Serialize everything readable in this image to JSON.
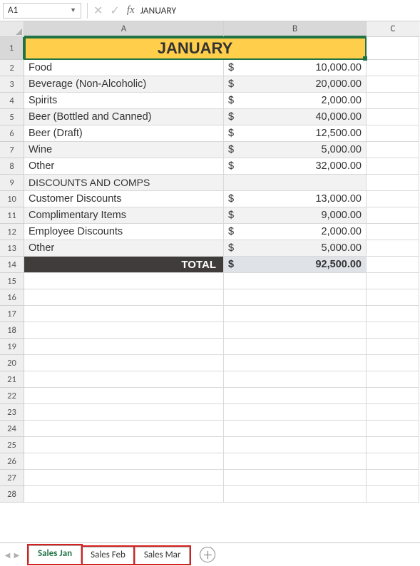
{
  "formula_bar": {
    "cell_ref": "A1",
    "formula_value": "JANUARY"
  },
  "columns": {
    "A": "A",
    "B": "B",
    "C": "C"
  },
  "title": "JANUARY",
  "items": [
    {
      "label": "Food",
      "amount": "10,000.00"
    },
    {
      "label": "Beverage (Non-Alcoholic)",
      "amount": "20,000.00"
    },
    {
      "label": "Spirits",
      "amount": "2,000.00"
    },
    {
      "label": "Beer (Bottled and Canned)",
      "amount": "40,000.00"
    },
    {
      "label": "Beer (Draft)",
      "amount": "12,500.00"
    },
    {
      "label": "Wine",
      "amount": "5,000.00"
    },
    {
      "label": "Other",
      "amount": "32,000.00"
    }
  ],
  "section_header": "DISCOUNTS AND COMPS",
  "discounts": [
    {
      "label": "Customer Discounts",
      "amount": "13,000.00"
    },
    {
      "label": "Complimentary Items",
      "amount": "9,000.00"
    },
    {
      "label": "Employee Discounts",
      "amount": "2,000.00"
    },
    {
      "label": "Other",
      "amount": "5,000.00"
    }
  ],
  "total": {
    "label": "TOTAL",
    "amount": "92,500.00"
  },
  "currency_symbol": "$",
  "row_headers": [
    "1",
    "2",
    "3",
    "4",
    "5",
    "6",
    "7",
    "8",
    "9",
    "10",
    "11",
    "12",
    "13",
    "14",
    "15",
    "16",
    "17",
    "18",
    "19",
    "20",
    "21",
    "22",
    "23",
    "24",
    "25",
    "26",
    "27",
    "28"
  ],
  "tabs": [
    {
      "label": "Sales  Jan",
      "active": true
    },
    {
      "label": "Sales Feb",
      "active": false
    },
    {
      "label": "Sales Mar",
      "active": false
    }
  ],
  "chart_data": {
    "type": "table",
    "title": "JANUARY",
    "rows": [
      [
        "Food",
        10000.0
      ],
      [
        "Beverage (Non-Alcoholic)",
        20000.0
      ],
      [
        "Spirits",
        2000.0
      ],
      [
        "Beer (Bottled and Canned)",
        40000.0
      ],
      [
        "Beer (Draft)",
        12500.0
      ],
      [
        "Wine",
        5000.0
      ],
      [
        "Other",
        32000.0
      ],
      [
        "Customer Discounts",
        13000.0
      ],
      [
        "Complimentary Items",
        9000.0
      ],
      [
        "Employee Discounts",
        2000.0
      ],
      [
        "Other",
        5000.0
      ]
    ],
    "total": 92500.0
  }
}
